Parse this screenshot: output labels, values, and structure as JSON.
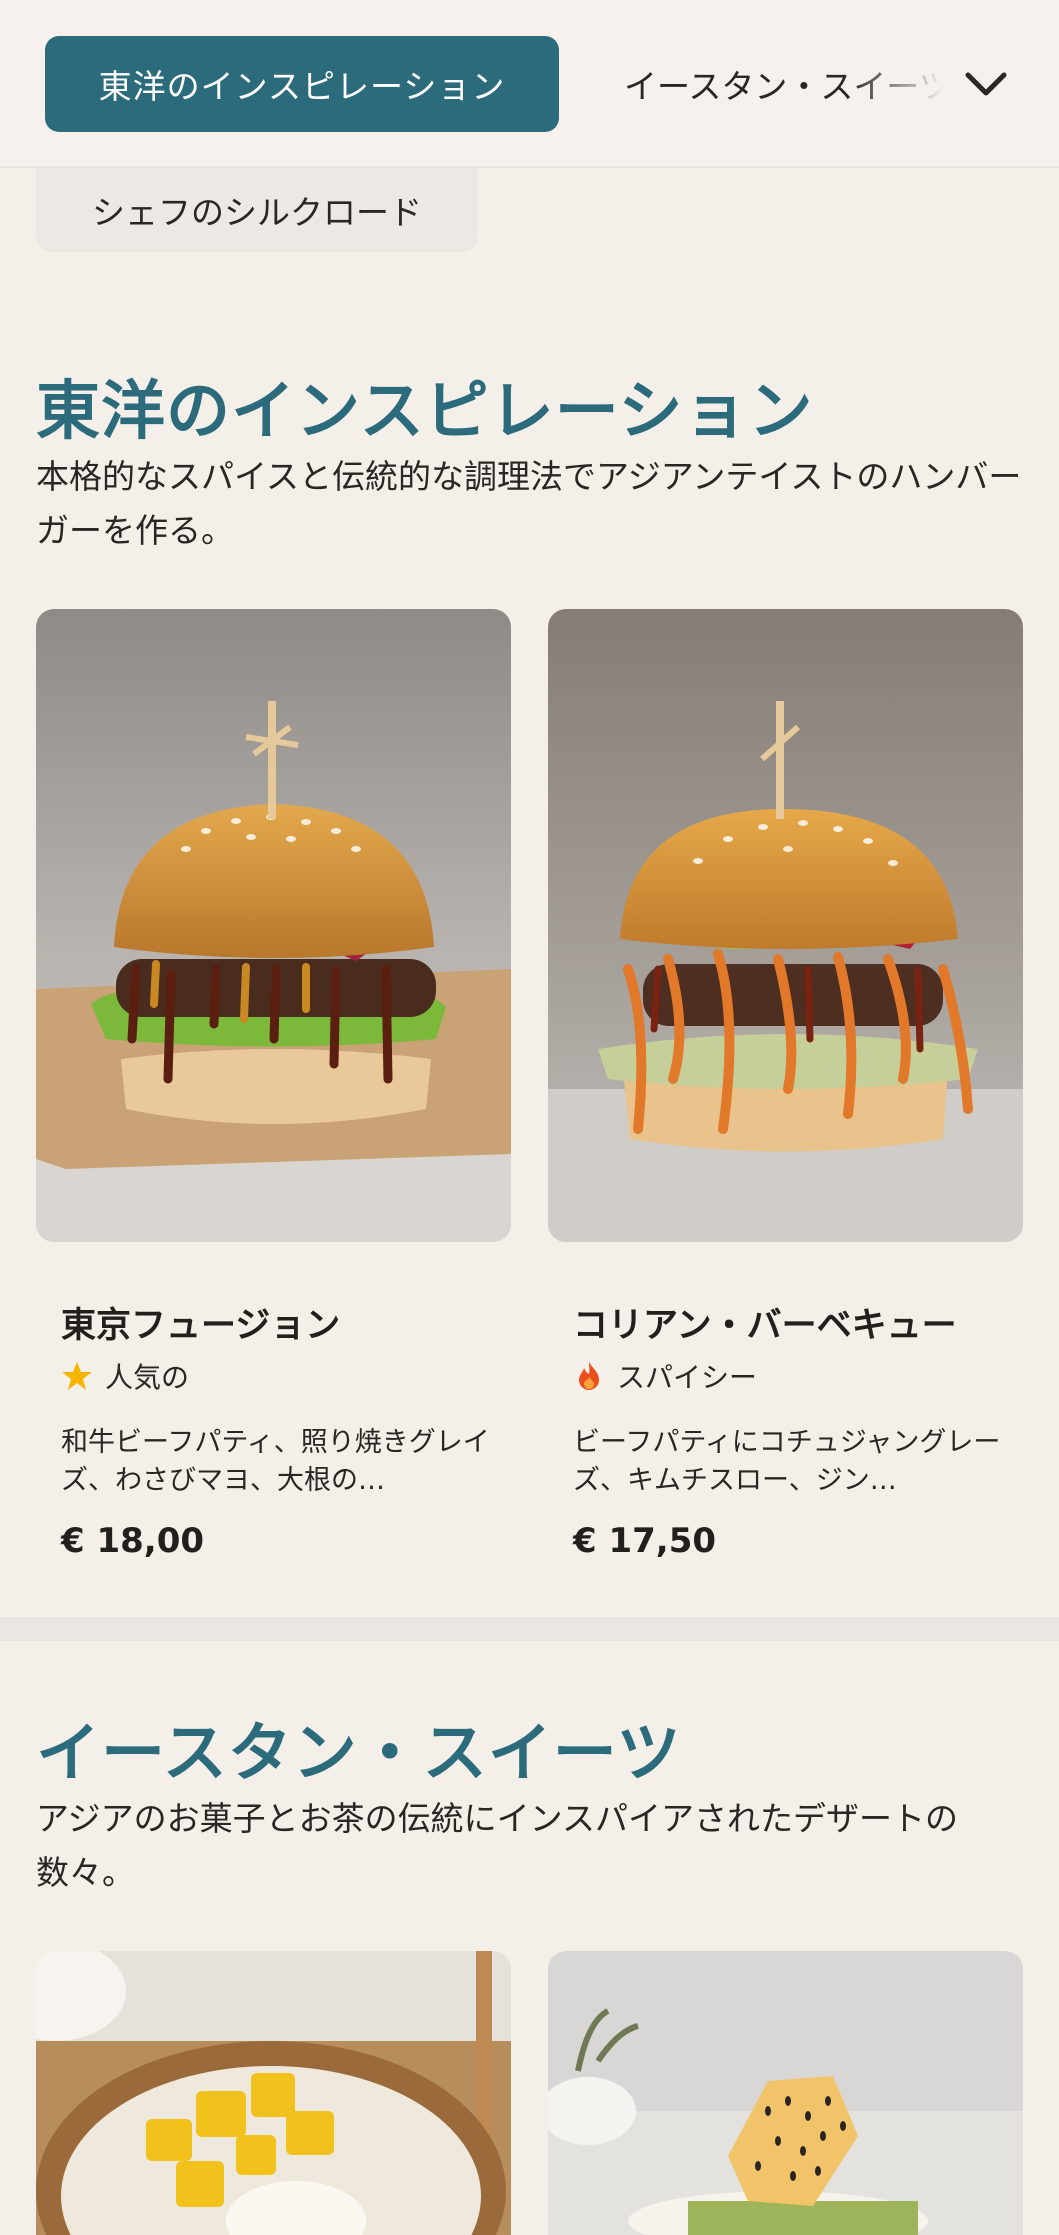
{
  "nav": {
    "active_tab": "東洋のインスピレーション",
    "next_tab": "イースタン・スイーツ",
    "prev_tab": "シェフのシルクロード",
    "expand_icon": "chevron-down-icon"
  },
  "sections": [
    {
      "title": "東洋のインスピレーション",
      "description": "本格的なスパイスと伝統的な調理法でアジアンテイストのハンバーガーを作る。",
      "items": [
        {
          "name": "東京フュージョン",
          "tag": "人気の",
          "tag_icon": "star-icon",
          "description": "和牛ビーフパティ、照り焼きグレイズ、わさびマヨ、大根の…",
          "price": "€ 18,00",
          "image": "burger-photo"
        },
        {
          "name": "コリアン・バーベキュー",
          "tag": "スパイシー",
          "tag_icon": "flame-icon",
          "description": "ビーフパティにコチュジャングレーズ、キムチスロー、ジン…",
          "price": "€ 17,50",
          "image": "burger-photo"
        }
      ]
    },
    {
      "title": "イースタン・スイーツ",
      "description": "アジアのお菓子とお茶の伝統にインスパイアされたデザートの数々。",
      "items": [
        {
          "image": "mango-sticky-rice-photo"
        },
        {
          "image": "sesame-dessert-photo"
        }
      ]
    }
  ],
  "colors": {
    "accent": "#2c6b7c",
    "background": "#f5efea",
    "star": "#f5b400",
    "flame": "#e8501c"
  }
}
